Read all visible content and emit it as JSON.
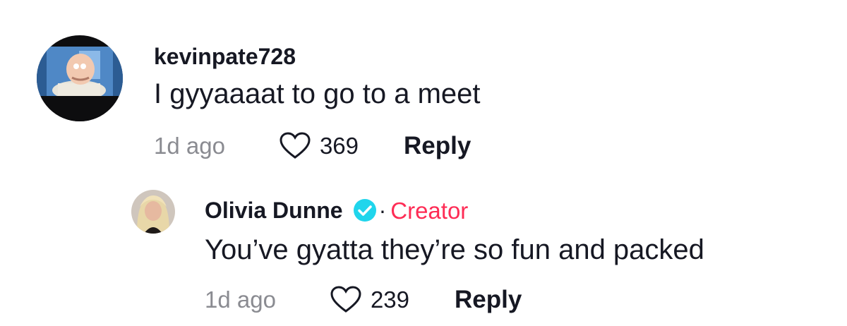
{
  "comment": {
    "username": "kevinpate728",
    "text": "I gyyaaaat to go to a meet",
    "time": "1d ago",
    "likes": "369",
    "reply_label": "Reply"
  },
  "reply_comment": {
    "username": "Olivia Dunne",
    "separator": "·",
    "badge": "Creator",
    "text": "You’ve gyatta they’re so fun and packed",
    "time": "1d ago",
    "likes": "239",
    "reply_label": "Reply"
  },
  "colors": {
    "creator_badge": "#fe2c55",
    "verified": "#20d5ec",
    "muted_text": "#8a8b91",
    "primary_text": "#161823"
  },
  "icons": {
    "like": "heart-outline-icon",
    "verified": "verified-check-icon"
  }
}
